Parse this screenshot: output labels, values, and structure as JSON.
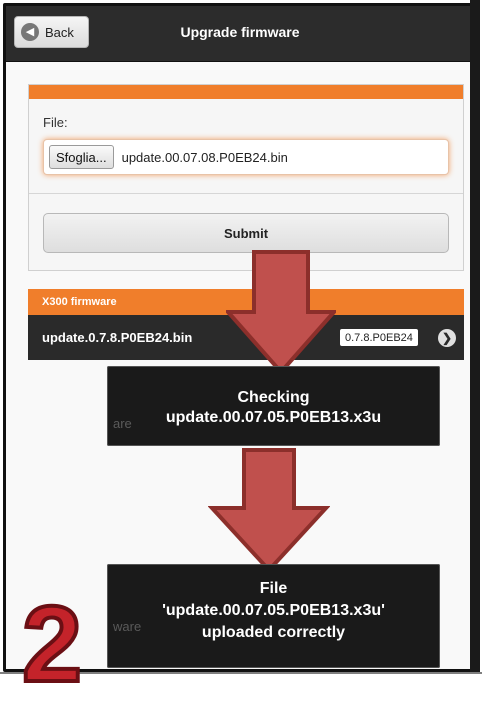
{
  "header": {
    "back_label": "Back",
    "title": "Upgrade firmware"
  },
  "upload_form": {
    "file_label": "File:",
    "browse_label": "Sfoglia...",
    "selected_file": "update.00.07.08.P0EB24.bin",
    "submit_label": "Submit"
  },
  "firmware_list": {
    "header": "X300 firmware",
    "items": [
      {
        "name": "update.0.7.8.P0EB24.bin",
        "version_badge": "0.7.8.P0EB24"
      }
    ]
  },
  "toasts": {
    "checking": {
      "line1": "Checking",
      "line2": "update.00.07.05.P0EB13.x3u",
      "ghost": "are"
    },
    "uploaded": {
      "line1": "File",
      "line2": "'update.00.07.05.P0EB13.x3u'",
      "line3": "uploaded correctly",
      "ghost": "ware"
    }
  },
  "annotation": {
    "step_number": "2"
  },
  "colors": {
    "accent": "#f07e2b",
    "arrow_fill": "#c0504d",
    "arrow_stroke": "#8c2f2b",
    "step_red": "#c4232a"
  }
}
